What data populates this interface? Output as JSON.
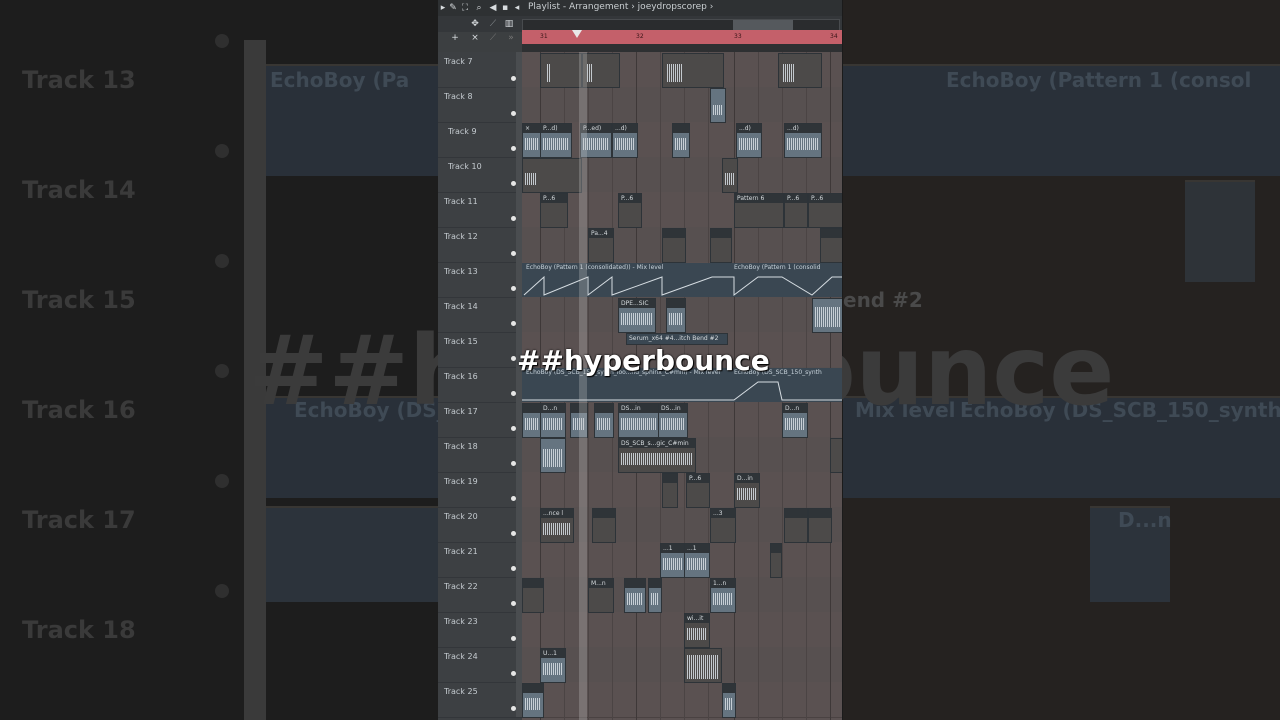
{
  "titlebar": {
    "title": "Playlist - Arrangement › joeydropscorep ›"
  },
  "timeline": {
    "bar_numbers": [
      "31",
      "32",
      "33",
      "34"
    ]
  },
  "tracks": [
    {
      "label": "Track 7"
    },
    {
      "label": "Track 8"
    },
    {
      "label": "Track 9"
    },
    {
      "label": "Track 10"
    },
    {
      "label": "Track 11"
    },
    {
      "label": "Track 12"
    },
    {
      "label": "Track 13"
    },
    {
      "label": "Track 14"
    },
    {
      "label": "Track 15"
    },
    {
      "label": "Track 16"
    },
    {
      "label": "Track 17"
    },
    {
      "label": "Track 18"
    },
    {
      "label": "Track 19"
    },
    {
      "label": "Track 20"
    },
    {
      "label": "Track 21"
    },
    {
      "label": "Track 22"
    },
    {
      "label": "Track 23"
    },
    {
      "label": "Track 24"
    },
    {
      "label": "Track 25"
    }
  ],
  "clips": {
    "t9_a": "P...d)",
    "t9_b": "P...ed)",
    "t9_c": "...d)",
    "t9_d": "...d)",
    "t9_e": "...d)",
    "t11_a": "P...6",
    "t11_b": "P...6",
    "t11_c": "Pattern 6",
    "t11_d": "P...6",
    "t11_e": "P...6",
    "t12_a": "Pa...4",
    "t13_a": "EchoBoy (Pattern 1 (consolidated)) - Mix level",
    "t13_b": "EchoBoy (Pattern 1 (consolid",
    "t14_a": "DPE...SIC",
    "t15_a": "Serum_x64 #4...itch Bend #2",
    "t16_a": "EchoBoy (DS_SCB_150_synth_loo...nd_sphinx_C#min) - Mix level",
    "t16_b": "EchoBoy (DS_SCB_150_synth",
    "t17_a": "D...n",
    "t17_b": "DS...in",
    "t17_c": "DS...in",
    "t17_d": "D...n",
    "t18_a": "DS_SCB_s...gic_C#min",
    "t19_a": "P...6",
    "t19_b": "D...in",
    "t20_a": "...nce l",
    "t20_b": "...3",
    "t21_a": "...1",
    "t21_b": "...1",
    "t22_a": "M...n",
    "t22_b": "1...n",
    "t23_a": "wi...it",
    "t24_a": "U...1"
  },
  "background": {
    "tracks": [
      "Track 13",
      "Track 14",
      "Track 15",
      "Track 16",
      "Track 17",
      "Track 18"
    ],
    "clip_text_1": "EchoBoy (Pa",
    "clip_text_2": "EchoBoy (Pattern 1 (consol",
    "clip_text_3": "EchoBoy (DS_",
    "clip_text_4": "Mix level",
    "clip_text_5": "EchoBoy (DS_SCB_150_synth",
    "clip_text_6": "end #2",
    "clip_text_7": "D...n",
    "hashtag": "##hyperbounce"
  },
  "overlay": {
    "hashtag": "##hyperbounce"
  },
  "colors": {
    "timeline": "#c4606a",
    "clip_audio": "#657480",
    "grid": "#5a5151"
  }
}
